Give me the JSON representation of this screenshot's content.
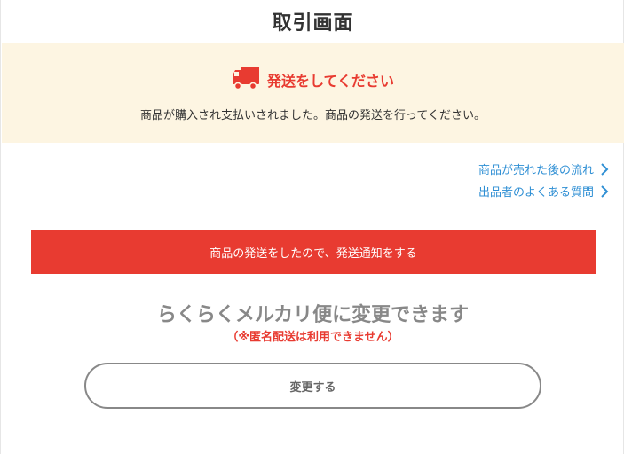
{
  "header": {
    "title": "取引画面"
  },
  "notice": {
    "icon": "truck-icon",
    "title": "発送をしてください",
    "body": "商品が購入され支払いされました。商品の発送を行ってください。"
  },
  "links": [
    {
      "label": "商品が売れた後の流れ",
      "icon": "chevron-right-icon"
    },
    {
      "label": "出品者のよくある質問",
      "icon": "chevron-right-icon"
    }
  ],
  "actions": {
    "ship_notify_label": "商品の発送をしたので、発送通知をする"
  },
  "promo": {
    "title": "らくらくメルカリ便に変更できます",
    "note": "（※匿名配送は利用できません）",
    "change_label": "変更する"
  },
  "colors": {
    "accent": "#e83b31",
    "link": "#2f8fd4",
    "notice_bg": "#fdf5e2",
    "muted": "#888888"
  }
}
